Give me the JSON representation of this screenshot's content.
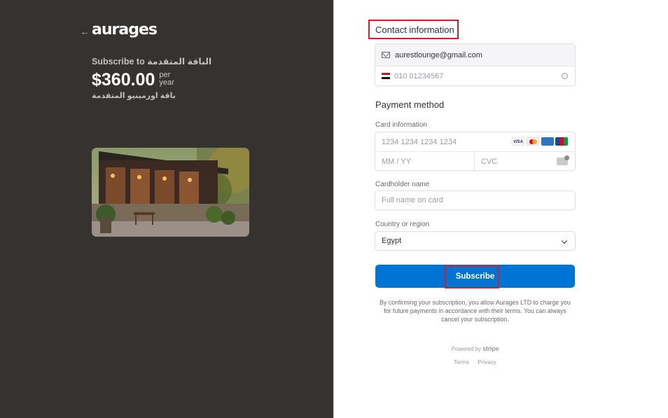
{
  "left": {
    "back_arrow": "←",
    "logo_text": "aurages",
    "subscribe_to": "Subscribe to الباقة المتقدمة",
    "price": "$360.00",
    "period_line1": "per",
    "period_line2": "year",
    "product_description": "باقة اورمينيو المتقدمة"
  },
  "contact": {
    "title": "Contact information",
    "email": "aurestlounge@gmail.com",
    "phone_placeholder": "010 01234567",
    "info_icon": "i"
  },
  "payment": {
    "title": "Payment method",
    "card_label": "Card information",
    "card_placeholder": "1234 1234 1234 1234",
    "expiry_placeholder": "MM / YY",
    "cvc_placeholder": "CVC",
    "brands": [
      "VISA",
      "",
      "AMEX",
      "JCB"
    ],
    "cardholder_label": "Cardholder name",
    "cardholder_placeholder": "Full name on card",
    "country_label": "Country or region",
    "country_value": "Egypt"
  },
  "subscribe_button": "Subscribe",
  "terms_text": "By confirming your subscription, you allow Aurages LTD to charge you for future payments in accordance with their terms. You can always cancel your subscription.",
  "footer": {
    "powered_by": "Powered by",
    "brand": "stripe",
    "terms": "Terms",
    "privacy": "Privacy"
  },
  "colors": {
    "left_bg": "#353230",
    "primary": "#0074d4",
    "highlight": "#d21f2b"
  }
}
